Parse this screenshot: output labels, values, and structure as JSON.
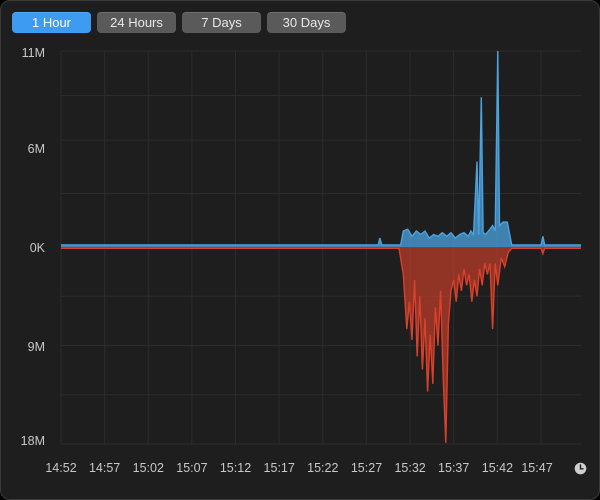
{
  "tabs": [
    {
      "label": "1 Hour",
      "active": true
    },
    {
      "label": "24 Hours",
      "active": false
    },
    {
      "label": "7 Days",
      "active": false
    },
    {
      "label": "30 Days",
      "active": false
    }
  ],
  "clock_icon": "clock-icon",
  "colors": {
    "background": "#1e1e1e",
    "accent": "#3d9bf2",
    "received": "#4ba3e0",
    "sent": "#d9412a",
    "grid": "#2c2c2c"
  },
  "chart_data": {
    "type": "area",
    "y_tick_labels": [
      "11M",
      "6M",
      "0K",
      "9M",
      "18M"
    ],
    "y_ticks": [
      11,
      6,
      0,
      -9,
      -18
    ],
    "ylim": [
      -18,
      11
    ],
    "x_tick_labels": [
      "14:52",
      "14:57",
      "15:02",
      "15:07",
      "15:12",
      "15:17",
      "15:22",
      "15:27",
      "15:32",
      "15:37",
      "15:42",
      "15:47"
    ],
    "xlim": [
      0,
      60
    ],
    "grid": true,
    "series": [
      {
        "role": "received",
        "color": "#4ba3e0",
        "points": [
          [
            0,
            0.12
          ],
          [
            36.6,
            0.12
          ],
          [
            36.8,
            0.5
          ],
          [
            37,
            0.12
          ],
          [
            39.2,
            0.12
          ],
          [
            39.5,
            0.9
          ],
          [
            40,
            1.0
          ],
          [
            40.5,
            0.6
          ],
          [
            41,
            0.9
          ],
          [
            41.5,
            0.7
          ],
          [
            42,
            0.9
          ],
          [
            42.5,
            0.5
          ],
          [
            43,
            0.7
          ],
          [
            43.5,
            0.6
          ],
          [
            44,
            0.8
          ],
          [
            44.5,
            0.6
          ],
          [
            45,
            0.8
          ],
          [
            45.5,
            0.5
          ],
          [
            46,
            0.7
          ],
          [
            46.5,
            0.8
          ],
          [
            47,
            0.6
          ],
          [
            47.3,
            0.9
          ],
          [
            47.6,
            0.7
          ],
          [
            48,
            4.8
          ],
          [
            48.2,
            0.7
          ],
          [
            48.5,
            8.4
          ],
          [
            48.7,
            0.8
          ],
          [
            49,
            0.7
          ],
          [
            49.5,
            1.0
          ],
          [
            49.8,
            1.2
          ],
          [
            50.1,
            0.9
          ],
          [
            50.4,
            11.0
          ],
          [
            50.6,
            1.2
          ],
          [
            51,
            1.4
          ],
          [
            51.5,
            1.4
          ],
          [
            52,
            0.12
          ],
          [
            55.4,
            0.12
          ],
          [
            55.6,
            0.6
          ],
          [
            55.8,
            0.12
          ],
          [
            60,
            0.12
          ]
        ]
      },
      {
        "role": "sent",
        "color": "#d9412a",
        "points": [
          [
            0,
            -0.12
          ],
          [
            39,
            -0.12
          ],
          [
            39.5,
            -2.5
          ],
          [
            39.9,
            -7.5
          ],
          [
            40.2,
            -5.0
          ],
          [
            40.5,
            -8.5
          ],
          [
            40.8,
            -3.0
          ],
          [
            41.1,
            -10.0
          ],
          [
            41.4,
            -4.5
          ],
          [
            41.7,
            -11.2
          ],
          [
            42,
            -6.5
          ],
          [
            42.3,
            -13.2
          ],
          [
            42.6,
            -8.0
          ],
          [
            42.9,
            -12.5
          ],
          [
            43.2,
            -5.5
          ],
          [
            43.5,
            -9.0
          ],
          [
            43.8,
            -4.0
          ],
          [
            44.1,
            -12.0
          ],
          [
            44.4,
            -17.9
          ],
          [
            44.7,
            -7.0
          ],
          [
            45,
            -4.0
          ],
          [
            45.3,
            -3.0
          ],
          [
            45.6,
            -5.0
          ],
          [
            45.9,
            -2.5
          ],
          [
            46.2,
            -4.0
          ],
          [
            46.5,
            -2.0
          ],
          [
            46.8,
            -3.5
          ],
          [
            47.1,
            -2.5
          ],
          [
            47.4,
            -5.0
          ],
          [
            47.7,
            -3.0
          ],
          [
            48,
            -4.5
          ],
          [
            48.3,
            -2.0
          ],
          [
            48.6,
            -3.5
          ],
          [
            48.9,
            -1.5
          ],
          [
            49.2,
            -2.5
          ],
          [
            49.5,
            -1.5
          ],
          [
            49.8,
            -7.5
          ],
          [
            50.1,
            -1.5
          ],
          [
            50.4,
            -3.5
          ],
          [
            50.8,
            -1.0
          ],
          [
            51.2,
            -1.8
          ],
          [
            51.6,
            -0.5
          ],
          [
            52,
            -0.12
          ],
          [
            55.4,
            -0.12
          ],
          [
            55.6,
            -0.6
          ],
          [
            55.8,
            -0.12
          ],
          [
            60,
            -0.12
          ]
        ]
      }
    ]
  }
}
